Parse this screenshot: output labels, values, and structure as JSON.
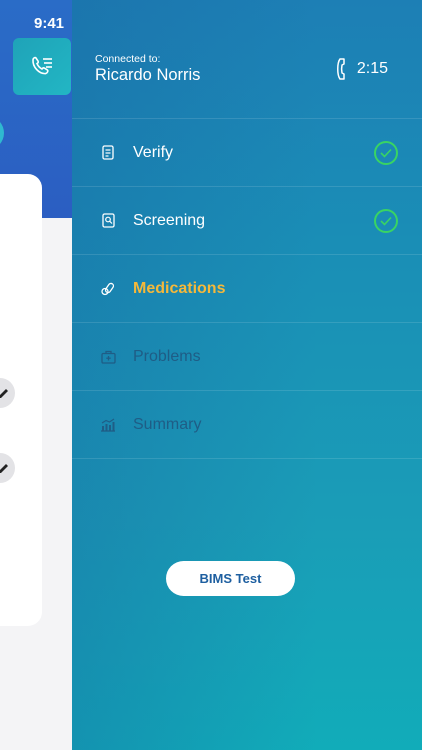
{
  "status_bar": {
    "time": "9:41",
    "icons": [
      "signal-icon",
      "wifi-icon",
      "battery-icon"
    ]
  },
  "connection": {
    "label": "Connected to:",
    "name": "Ricardo Norris",
    "call_duration": "2:15"
  },
  "menu": {
    "items": [
      {
        "label": "Verify",
        "state": "completed",
        "icon": "document-icon"
      },
      {
        "label": "Screening",
        "state": "completed",
        "icon": "screening-icon"
      },
      {
        "label": "Medications",
        "state": "active",
        "icon": "pills-icon"
      },
      {
        "label": "Problems",
        "state": "disabled",
        "icon": "medical-bag-icon"
      },
      {
        "label": "Summary",
        "state": "disabled",
        "icon": "chart-icon"
      }
    ]
  },
  "actions": {
    "bims_label": "BIMS Test"
  },
  "colors": {
    "active": "#f5b83a",
    "check": "#39d463",
    "disabled": "#1f5d86",
    "drawer_top": "#1d7fb5",
    "drawer_bottom": "#11acb9",
    "header_blue": "#2a6cc7"
  }
}
